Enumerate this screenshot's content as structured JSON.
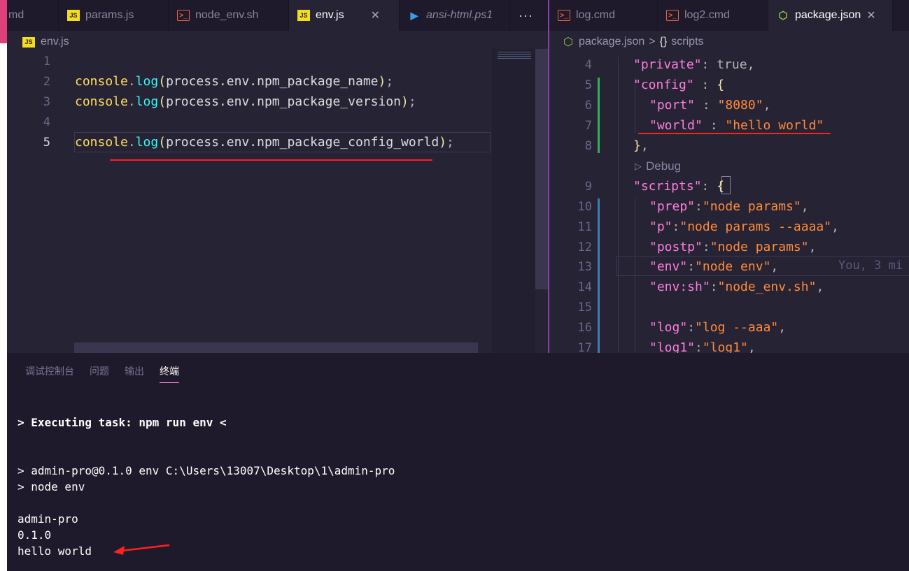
{
  "tabs_left": [
    {
      "label": "md",
      "icon": "terminal-icon"
    },
    {
      "label": "params.js",
      "icon": "js-icon"
    },
    {
      "label": "node_env.sh",
      "icon": "terminal-icon"
    },
    {
      "label": "env.js",
      "icon": "js-icon",
      "active": true
    },
    {
      "label": "ansi-html.ps1",
      "icon": "powershell-icon"
    }
  ],
  "tabs_left_more": "···",
  "tabs_right": [
    {
      "label": "log.cmd",
      "icon": "terminal-icon"
    },
    {
      "label": "log2.cmd",
      "icon": "terminal-icon"
    },
    {
      "label": "package.json",
      "icon": "nodejs-icon",
      "active": true
    }
  ],
  "breadcrumb_left": "env.js",
  "breadcrumb_right": {
    "file": "package.json",
    "separator": ">",
    "symbol": "{}",
    "section": "scripts"
  },
  "editor_left": {
    "line_numbers": [
      "1",
      "2",
      "3",
      "4",
      "5"
    ],
    "lines": [
      "",
      "console.log(process.env.npm_package_name);",
      "console.log(process.env.npm_package_version);",
      "",
      "console.log(process.env.npm_package_config_world);"
    ]
  },
  "editor_right": {
    "line_numbers": [
      "4",
      "5",
      "6",
      "7",
      "8",
      "9",
      "10",
      "11",
      "12",
      "13",
      "14",
      "15",
      "16",
      "17"
    ],
    "codelens": "Debug",
    "blame": "You, 3 mi",
    "lines": [
      "\"private\": true,",
      "\"config\" : {",
      "\"port\" : \"8080\",",
      "\"world\" : \"hello world\"",
      "},",
      "\"scripts\": {",
      "\"prep\":\"node params\",",
      "\"p\":\"node params --aaaa\",",
      "\"postp\":\"node params\",",
      "\"env\":\"node env\",",
      "\"env:sh\":\"node_env.sh\",",
      "",
      "\"log\":\"log --aaa\",",
      "\"log1\":\"log1\","
    ]
  },
  "panel": {
    "tabs": [
      "调试控制台",
      "问题",
      "输出",
      "终端"
    ],
    "active_tab": "终端",
    "terminal": [
      "> Executing task: npm run env <",
      "> admin-pro@0.1.0 env C:\\Users\\13007\\Desktop\\1\\admin-pro",
      "> node env",
      "admin-pro",
      "0.1.0",
      "hello world"
    ]
  },
  "colors": {
    "accent": "#ff7edb",
    "annotation_red": "#ff2020",
    "background": "#262335"
  }
}
